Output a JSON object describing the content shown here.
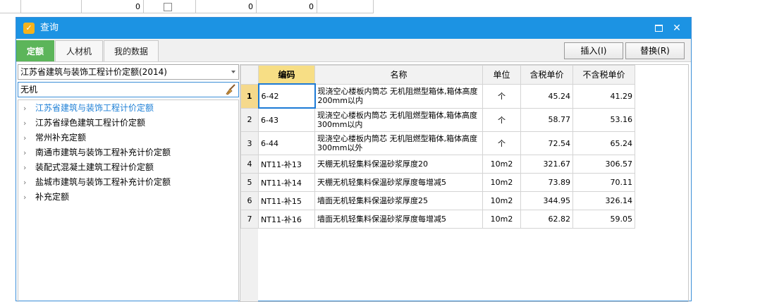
{
  "background_row": {
    "values": [
      "0",
      "0",
      "0"
    ]
  },
  "window": {
    "title": "查询"
  },
  "tabs": [
    {
      "label": "定额",
      "active": true
    },
    {
      "label": "人材机",
      "active": false
    },
    {
      "label": "我的数据",
      "active": false
    }
  ],
  "actions": {
    "insert_label": "插入(I)",
    "replace_label": "替换(R)"
  },
  "library_select": {
    "value": "江苏省建筑与装饰工程计价定额(2014)"
  },
  "search": {
    "value": "无机"
  },
  "tree": [
    {
      "label": "江苏省建筑与装饰工程计价定额",
      "selected": true
    },
    {
      "label": "江苏省绿色建筑工程计价定额",
      "selected": false
    },
    {
      "label": "常州补充定额",
      "selected": false
    },
    {
      "label": "南通市建筑与装饰工程补充计价定额",
      "selected": false
    },
    {
      "label": "装配式混凝土建筑工程计价定额",
      "selected": false
    },
    {
      "label": "盐城市建筑与装饰工程补充计价定额",
      "selected": false
    },
    {
      "label": "补充定额",
      "selected": false
    }
  ],
  "table": {
    "headers": [
      "编码",
      "名称",
      "单位",
      "含税单价",
      "不含税单价"
    ],
    "rows": [
      {
        "index": "1",
        "code": "6-42",
        "name": "现浇空心楼板内筒芯 无机阻燃型箱体,箱体高度 200mm以内",
        "unit": "个",
        "price_tax": "45.24",
        "price_notax": "41.29"
      },
      {
        "index": "2",
        "code": "6-43",
        "name": "现浇空心楼板内筒芯 无机阻燃型箱体,箱体高度 300mm以内",
        "unit": "个",
        "price_tax": "58.77",
        "price_notax": "53.16"
      },
      {
        "index": "3",
        "code": "6-44",
        "name": "现浇空心楼板内筒芯 无机阻燃型箱体,箱体高度 300mm以外",
        "unit": "个",
        "price_tax": "72.54",
        "price_notax": "65.24"
      },
      {
        "index": "4",
        "code": "NT11-补13",
        "name": "天棚无机轻集料保温砂浆厚度20",
        "unit": "10m2",
        "price_tax": "321.67",
        "price_notax": "306.57"
      },
      {
        "index": "5",
        "code": "NT11-补14",
        "name": "天棚无机轻集料保温砂浆厚度每增减5",
        "unit": "10m2",
        "price_tax": "73.89",
        "price_notax": "70.11"
      },
      {
        "index": "6",
        "code": "NT11-补15",
        "name": "墙面无机轻集料保温砂浆厚度25",
        "unit": "10m2",
        "price_tax": "344.95",
        "price_notax": "326.14"
      },
      {
        "index": "7",
        "code": "NT11-补16",
        "name": "墙面无机轻集料保温砂浆厚度每增减5",
        "unit": "10m2",
        "price_tax": "62.82",
        "price_notax": "59.05"
      }
    ]
  },
  "colors": {
    "titlebar": "#1c93e3",
    "active_tab": "#5cb55a",
    "header_highlight": "#f7de85",
    "selected_tree": "#1d7fd6"
  }
}
